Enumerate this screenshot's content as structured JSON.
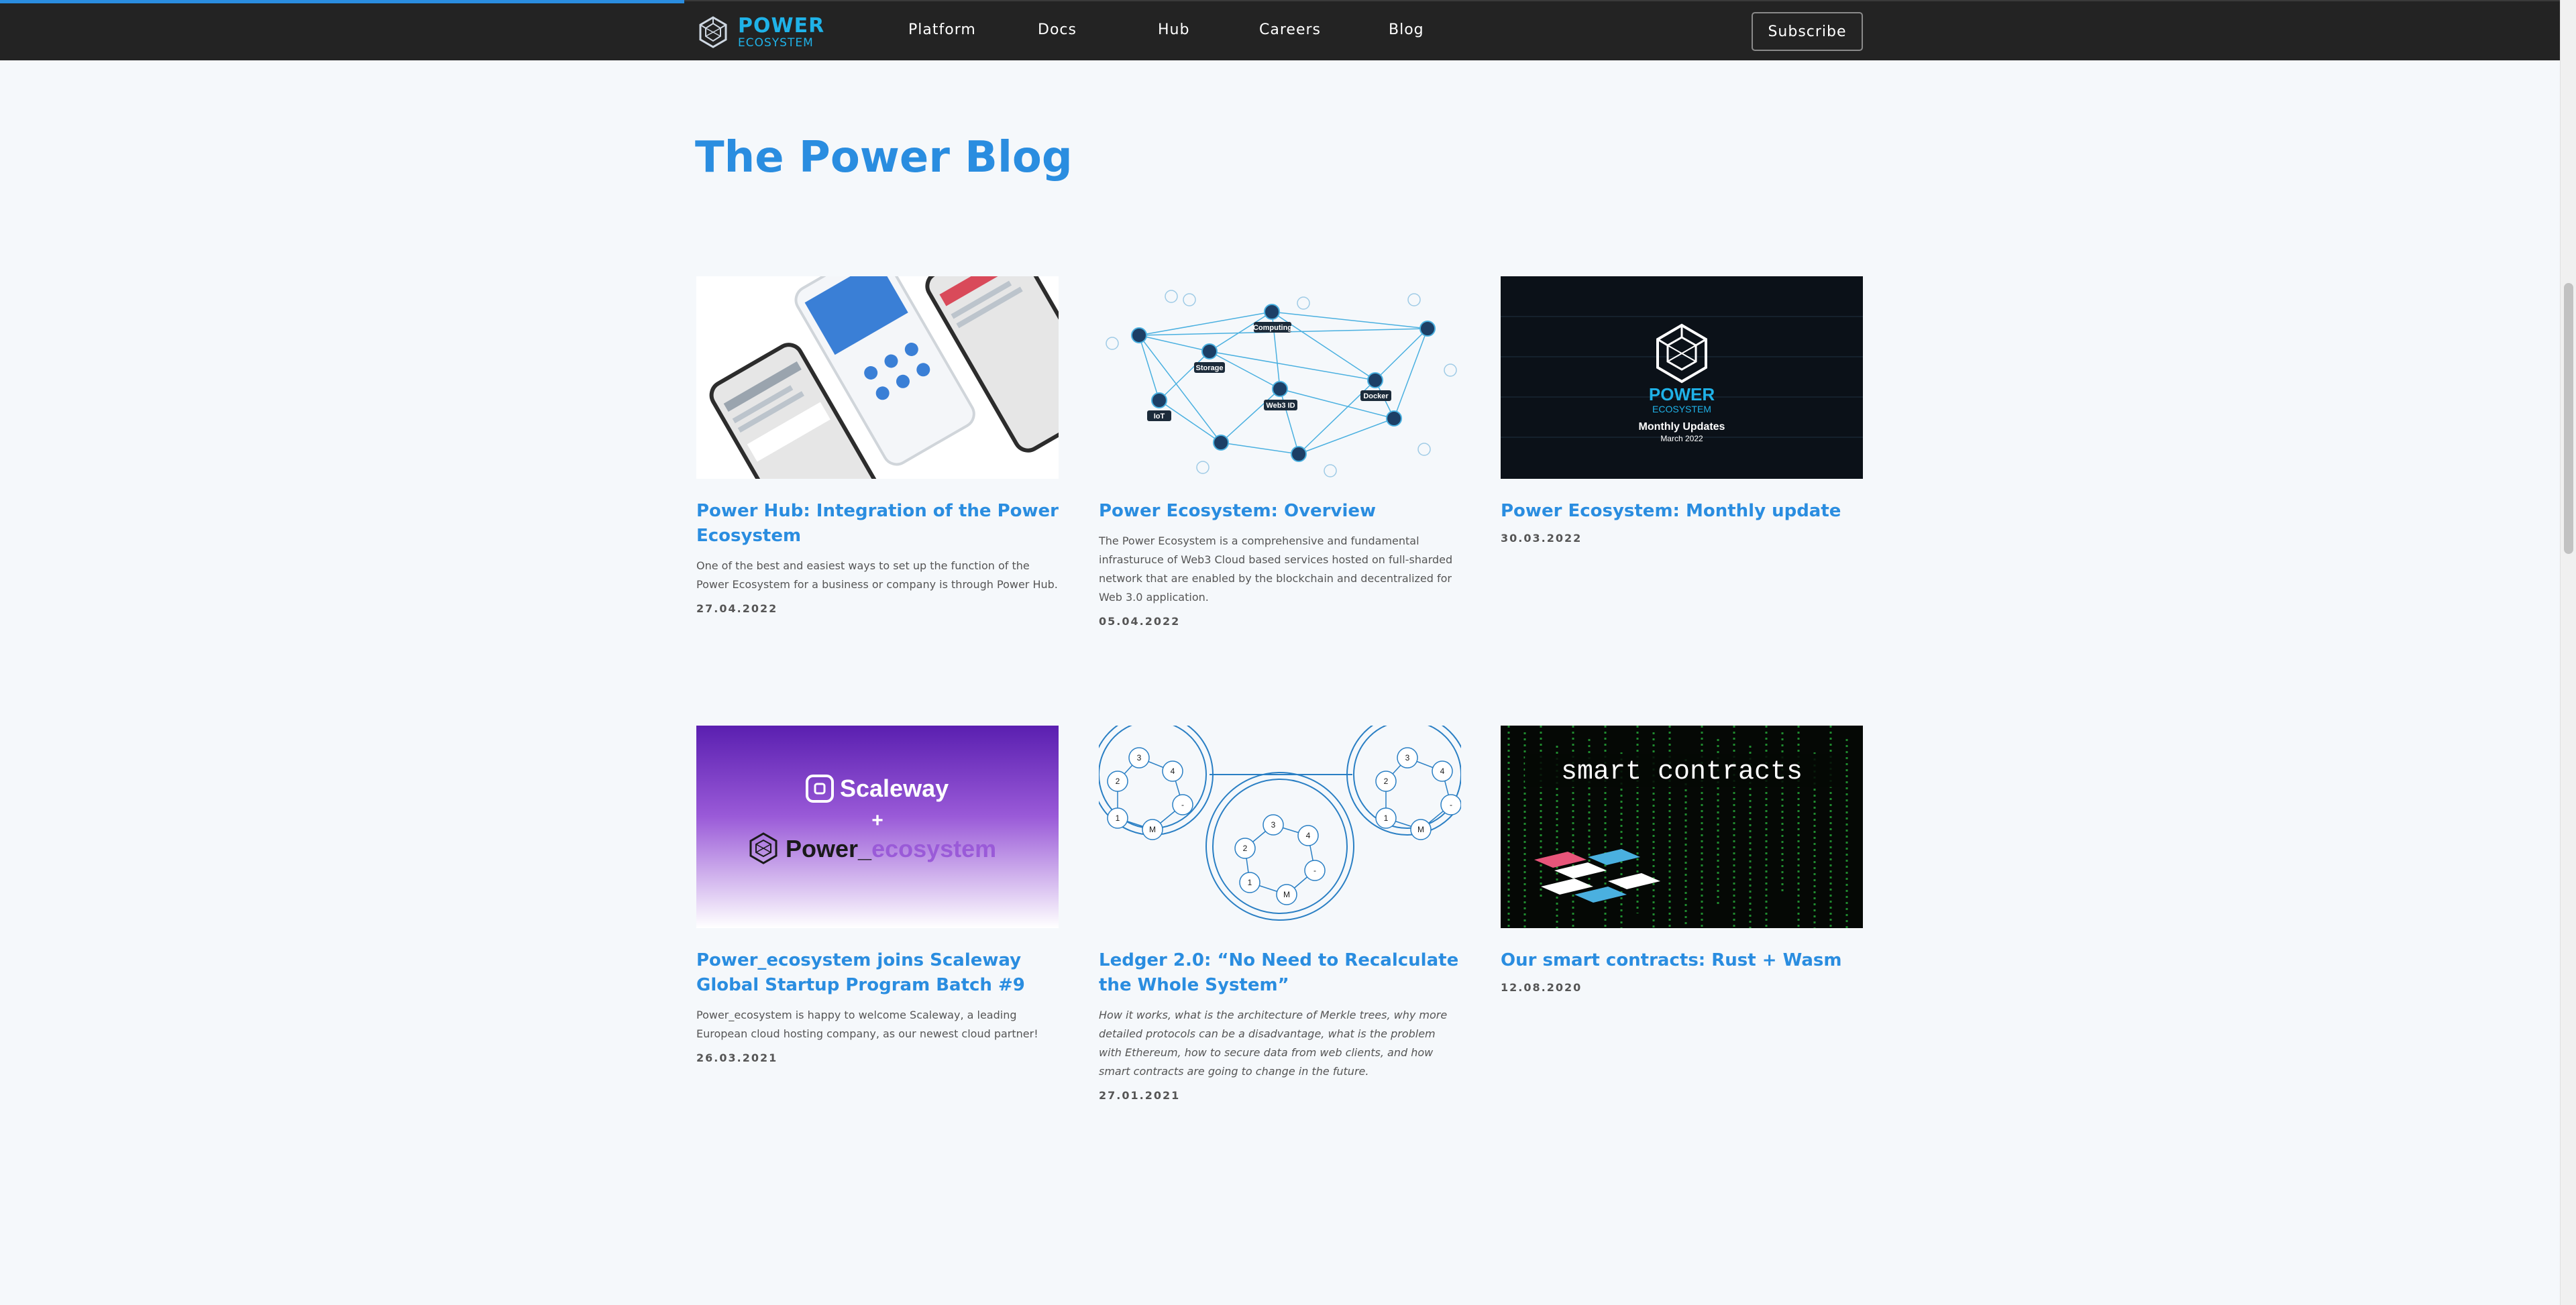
{
  "nav": {
    "logo_line1": "POWER",
    "logo_line2": "ECOSYSTEM",
    "items": [
      "Platform",
      "Docs",
      "Hub",
      "Careers",
      "Blog"
    ],
    "subscribe_label": "Subscribe"
  },
  "page_title": "The Power Blog",
  "posts": [
    {
      "title": "Power Hub: Integration of the Power Ecosystem",
      "description": "One of the best and easiest ways to set up the function of the Power Ecosystem for a business or company is through Power Hub.",
      "date": "27.04.2022",
      "image": "phone-mockups"
    },
    {
      "title": "Power Ecosystem: Overview",
      "description": "The Power Ecosystem is a comprehensive and fundamental infrasturuce of Web3 Cloud based services hosted on full-sharded network that are enabled by the blockchain and decentralized for Web 3.0 application.",
      "date": "05.04.2022",
      "image": "network-graph",
      "image_labels": [
        "Computing",
        "Storage",
        "Web3 ID",
        "Docker",
        "IoT"
      ]
    },
    {
      "title": "Power Ecosystem: Monthly update",
      "description": "",
      "date": "30.03.2022",
      "image": "monthly-update-banner",
      "image_labels": [
        "POWER",
        "ECOSYSTEM",
        "Monthly Updates",
        "March 2022"
      ]
    },
    {
      "title": "Power_ecosystem joins Scaleway Global Startup Program Batch #9",
      "description": "Power_ecosystem is happy to welcome Scaleway, a leading European cloud hosting company, as our newest cloud partner!",
      "date": "26.03.2021",
      "image": "scaleway-partnership",
      "image_labels": [
        "Scaleway",
        "+",
        "Power_",
        "ecosystem"
      ]
    },
    {
      "title": "Ledger 2.0: “No Need to Recalculate the Whole System”",
      "description": "How it works, what is the architecture of Merkle trees, why more detailed protocols can be a disadvantage, what is the problem with Ethereum, how to secure data from web clients, and how smart contracts are going to change in the future.",
      "date": "27.01.2021",
      "image": "ledger-circles",
      "image_labels": [
        "1",
        "2",
        "3",
        "4",
        "M",
        "-"
      ]
    },
    {
      "title": "Our smart contracts: Rust + Wasm",
      "description": "",
      "date": "12.08.2020",
      "image": "smart-contracts-matrix",
      "image_labels": [
        "smart contracts"
      ]
    }
  ],
  "colors": {
    "accent": "#2a8de0",
    "nav_bg": "#232323",
    "page_bg": "#f5f8fb",
    "logo": "#1fb2e8"
  }
}
